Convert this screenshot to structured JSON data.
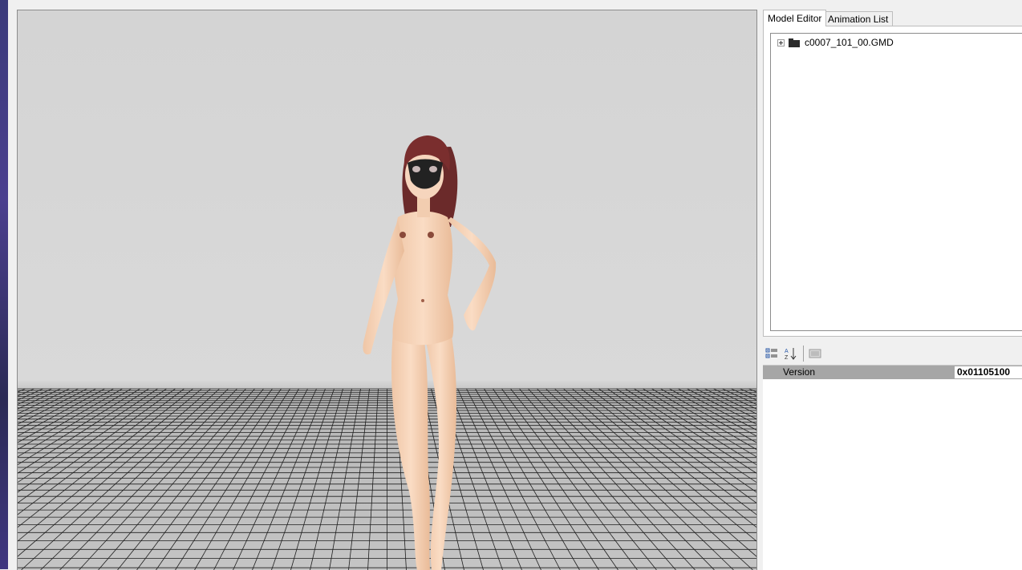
{
  "tabs": [
    {
      "label": "Model Editor",
      "active": true
    },
    {
      "label": "Animation List",
      "active": false
    }
  ],
  "tree": {
    "root": {
      "label": "c0007_101_00.GMD",
      "expanded": false
    }
  },
  "property_grid": {
    "toolbar": [
      "categorized-icon",
      "sort-az-icon",
      "property-pages-icon"
    ],
    "rows": [
      {
        "name": "Version",
        "value": "0x01105100"
      }
    ]
  },
  "viewport": {
    "background_color": "#d6d6d6",
    "grid_color": "#1e1e1e"
  }
}
